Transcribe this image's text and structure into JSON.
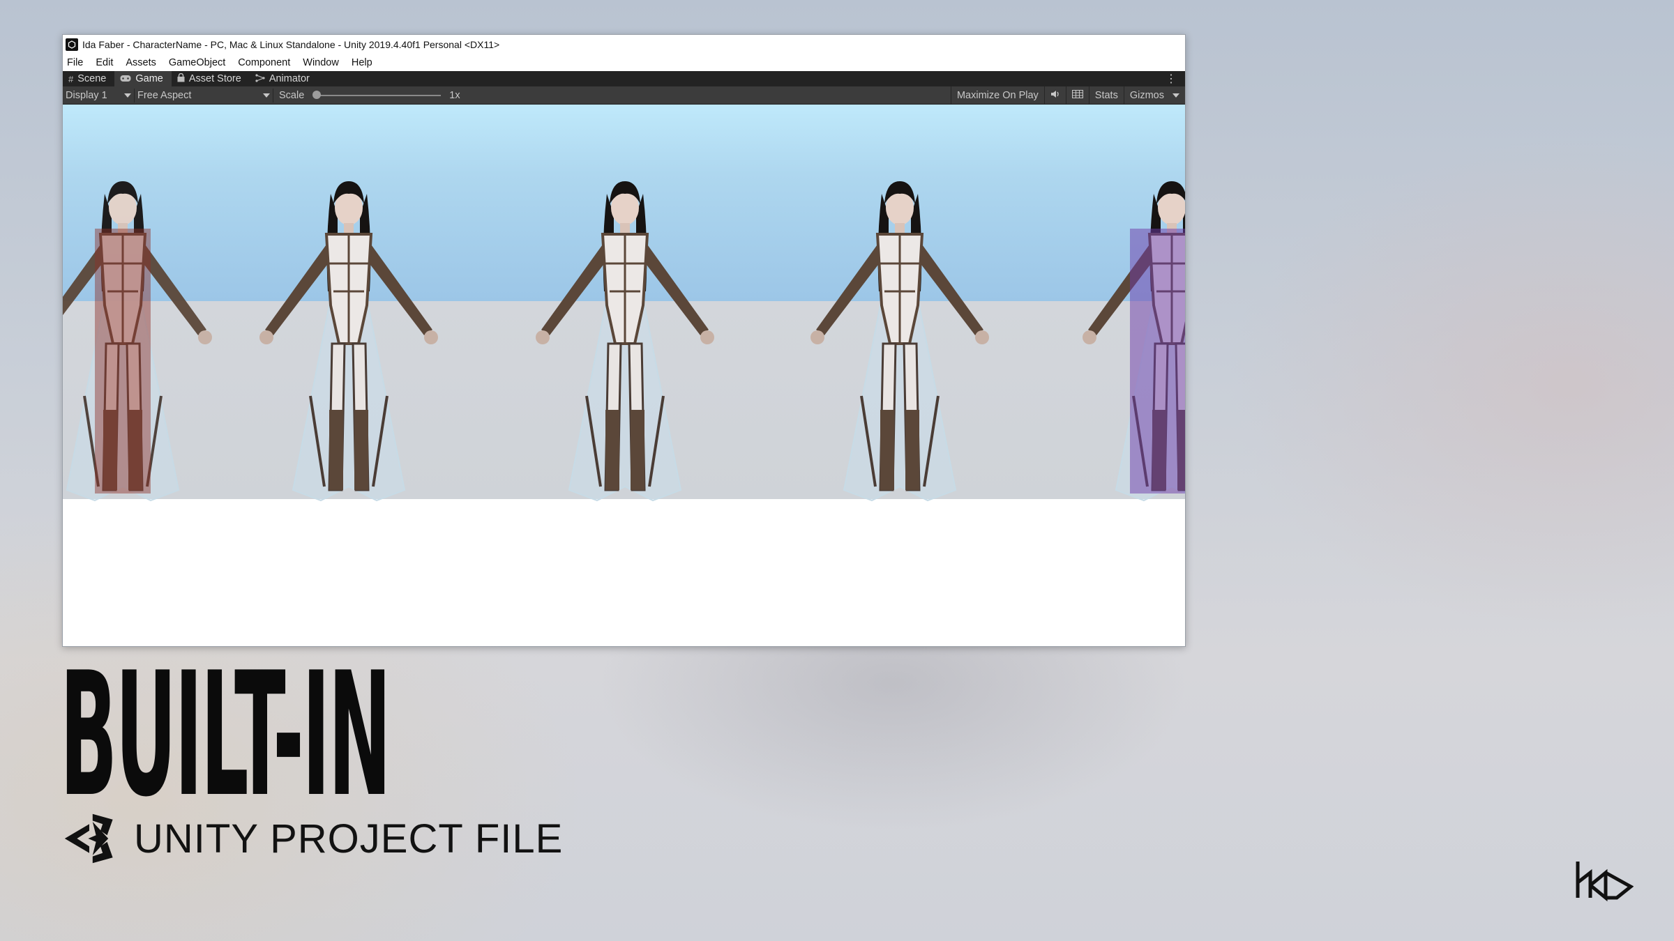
{
  "window": {
    "title": "Ida Faber - CharacterName - PC, Mac & Linux Standalone - Unity 2019.4.40f1 Personal <DX11>"
  },
  "menu": [
    "File",
    "Edit",
    "Assets",
    "GameObject",
    "Component",
    "Window",
    "Help"
  ],
  "tabs": [
    {
      "label": "Scene",
      "icon": "grid-icon"
    },
    {
      "label": "Game",
      "icon": "gamepad-icon",
      "active": true
    },
    {
      "label": "Asset Store",
      "icon": "lock-icon"
    },
    {
      "label": "Animator",
      "icon": "animator-icon"
    }
  ],
  "toolbar": {
    "display": "Display 1",
    "aspect": "Free Aspect",
    "scale_label": "Scale",
    "scale_value": "1x",
    "maximize": "Maximize On Play",
    "stats": "Stats",
    "gizmos": "Gizmos"
  },
  "viewport": {
    "characters": [
      {
        "variant": "red",
        "partial": "left"
      },
      {
        "variant": "white"
      },
      {
        "variant": "white"
      },
      {
        "variant": "white"
      },
      {
        "variant": "purple",
        "partial": "right"
      }
    ]
  },
  "slide": {
    "headline": "BUILT-IN",
    "subtitle": "UNITY PROJECT FILE"
  },
  "colors": {
    "sky": "#aed7ef",
    "wall": "#d1d5da",
    "editor_dark": "#3c3c3c",
    "headline": "#0b0b0b"
  }
}
